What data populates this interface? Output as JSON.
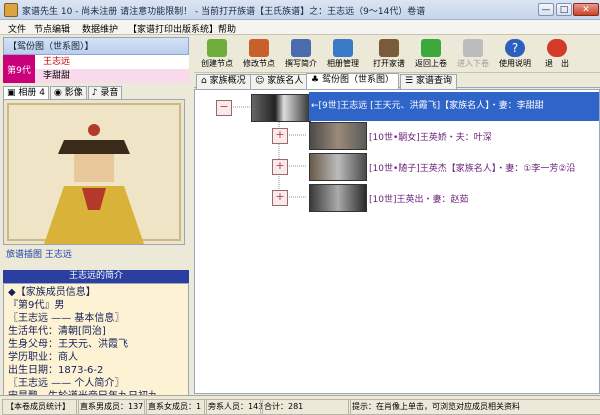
{
  "window": {
    "title": "家谱先生 10 - 尚未注册 请注意功能限制！ - 当前打开族谱【王氏族谱】之：王志远（9～14代）卷谱",
    "min": "—",
    "max": "□",
    "close": "✕"
  },
  "menu": [
    "文件",
    "节点编辑",
    "数据维护",
    "【家谱打印出版系统】",
    "帮助"
  ],
  "left_panel": {
    "header": "【鸳份图（世系图）】",
    "generation_label": "第9代",
    "person_name": "王志远",
    "spouse_name": "李甜甜",
    "tabs": [
      "相册 4",
      "影像",
      "录音"
    ],
    "photo_caption": "旅谱插图 王志远",
    "bio_title": "王志远的简介",
    "bio_lines": [
      "◆【家族成员信息】",
      "  『第9代』男",
      "  〖王志远 —— 基本信息〗",
      "    生活年代：清朝[同治]",
      "    生身父母：王天元、洪霞飞",
      "    学历职业：商人",
      "    出生日期：1873-6-2",
      "  〖王志远 —— 个人简介〗",
      "  宋昊鹏　生於道光帝巳年九日初九"
    ]
  },
  "toolbar": {
    "buttons": [
      {
        "label": "创建节点",
        "icon": "create-node-icon",
        "color": "#6fae3c"
      },
      {
        "label": "修改节点",
        "icon": "edit-node-icon",
        "color": "#c8602a"
      },
      {
        "label": "撰写简介",
        "icon": "write-intro-icon",
        "color": "#4a6bb0"
      },
      {
        "label": "相册管理",
        "icon": "camera-icon",
        "color": "#3a78c8"
      },
      {
        "label": "打开家谱",
        "icon": "open-book-icon",
        "color": "#7a5a3a"
      },
      {
        "label": "返回上卷",
        "icon": "back-arrow-icon",
        "color": "#3aa83a"
      },
      {
        "label": "进入下卷",
        "icon": "forward-arrow-icon",
        "color": "#a8a8a8"
      },
      {
        "label": "使用说明",
        "icon": "help-icon",
        "color": "#2d5fc0"
      },
      {
        "label": "退　出",
        "icon": "exit-icon",
        "color": "#d23a2a"
      }
    ]
  },
  "main_tabs": [
    "家族概况",
    "家族名人",
    "鸳份图（世系图）",
    "家谱查询"
  ],
  "tree": {
    "root": "←[9世]王志远 [王天元、洪霞飞]【家族名人】・妻：李甜甜",
    "children": [
      "[10世•嗣女]王英娇・夫：叶深",
      "[10世•随子]王英杰【家族名人】・妻：①李一芳②沿",
      "[10世]王英出・妻：赵茹"
    ]
  },
  "status": {
    "section": "【本卷成员统计】",
    "direct_male": "直系男成员：137",
    "direct_female": "直系女成员：1",
    "collateral": "旁系人员：143",
    "total": "合计：281",
    "hint": "提示：在肖像上单击，可浏览对应成员相关资料"
  }
}
